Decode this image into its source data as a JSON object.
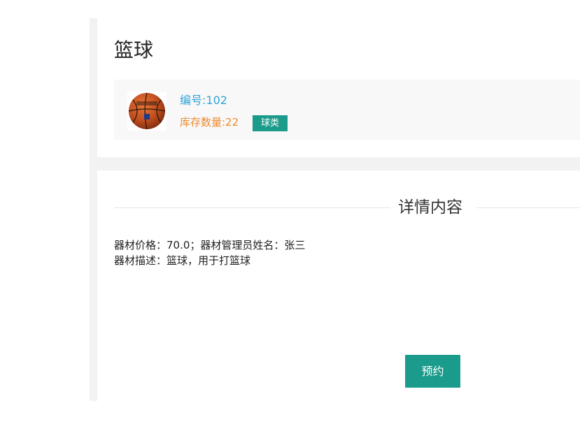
{
  "product": {
    "title": "篮球",
    "code_text": "编号:102",
    "stock_text": "库存数量:22",
    "category_tag": "球类",
    "image_icon": "basketball-image"
  },
  "detail": {
    "section_title": "详情内容",
    "line1": "器材价格：70.0；器材管理员姓名：张三",
    "line2": "器材描述：篮球，用于打篮球",
    "reserve_label": "预约"
  },
  "colors": {
    "accent": "#1a9b8b",
    "code_color": "#2fa4d9",
    "stock_color": "#ef8a2e",
    "page_bg": "#f2f2f2"
  }
}
